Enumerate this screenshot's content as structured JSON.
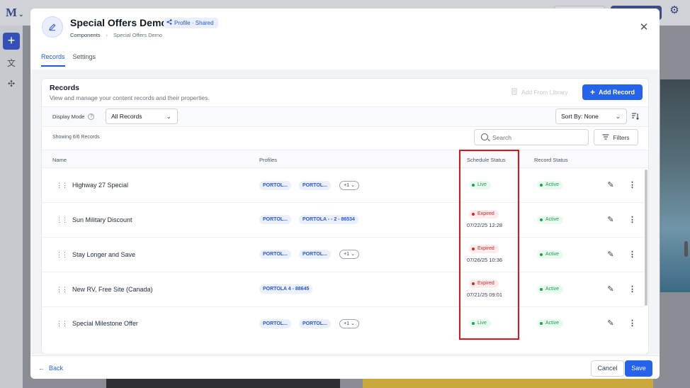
{
  "background": {
    "logo": "M",
    "logo_suffix": "⌄"
  },
  "modal": {
    "title": "Special Offers Demo",
    "badge": "Profile · Shared",
    "breadcrumb": [
      "Components",
      "Special Offers Demo"
    ],
    "tabs": [
      {
        "label": "Records",
        "active": true
      },
      {
        "label": "Settings",
        "active": false
      }
    ]
  },
  "card": {
    "title": "Records",
    "subtitle": "View and manage your content records and their properties.",
    "add_from_library": "Add From Library",
    "add_record": "Add Record"
  },
  "toolbar": {
    "display_mode_label": "Display Mode",
    "display_mode_value": "All Records",
    "sort_by": "Sort By: None",
    "showing": "Showing 6/6 Records",
    "search_placeholder": "Search",
    "filters": "Filters"
  },
  "table": {
    "columns": [
      "Name",
      "Profiles",
      "Schedule Status",
      "Record Status"
    ],
    "rows": [
      {
        "name": "Highway 27 Special",
        "profiles": [
          "PORTOL...",
          "PORTOL..."
        ],
        "more": "+1",
        "schedule": "Live",
        "schedule_date": "",
        "record_status": "Active"
      },
      {
        "name": "Sun Military Discount",
        "profiles": [
          "PORTOL...",
          "PORTOLA - - 2 - 86534"
        ],
        "more": "",
        "schedule": "Expired",
        "schedule_date": "07/22/25 12:28",
        "record_status": "Active"
      },
      {
        "name": "Stay Longer and Save",
        "profiles": [
          "PORTOL...",
          "PORTOL..."
        ],
        "more": "+1",
        "schedule": "Expired",
        "schedule_date": "07/26/25 10:36",
        "record_status": "Active"
      },
      {
        "name": "New RV, Free Site (Canada)",
        "profiles": [
          "PORTOLA 4 - 88645"
        ],
        "more": "",
        "schedule": "Expired",
        "schedule_date": "07/21/25 09:01",
        "record_status": "Active"
      },
      {
        "name": "Special Milestone Offer",
        "profiles": [
          "PORTOL...",
          "PORTOL..."
        ],
        "more": "+1",
        "schedule": "Live",
        "schedule_date": "",
        "record_status": "Active"
      }
    ]
  },
  "footer": {
    "back": "Back",
    "cancel": "Cancel",
    "save": "Save"
  },
  "colors": {
    "primary": "#2563eb",
    "live": "#16a34a",
    "expired": "#dc2626",
    "highlight_box": "#e0141e"
  }
}
